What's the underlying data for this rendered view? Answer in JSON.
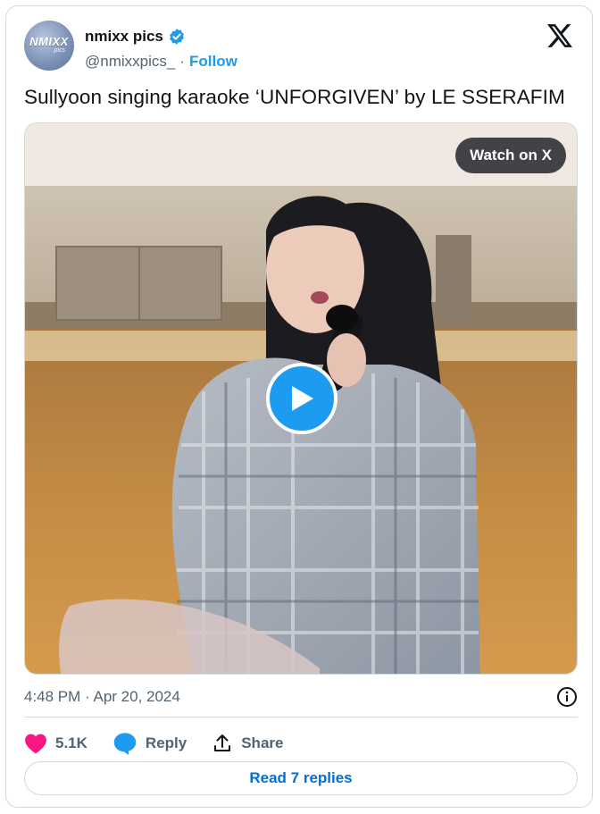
{
  "author": {
    "avatar_text": "NMIXX",
    "avatar_sub": "pics",
    "display_name": "nmixx pics",
    "handle": "@nmixxpics_",
    "separator": "·",
    "follow_label": "Follow"
  },
  "tweet": {
    "text": "Sullyoon singing karaoke ‘UNFORGIVEN’ by LE SSERAFIM"
  },
  "media": {
    "watch_label": "Watch on X"
  },
  "meta": {
    "timestamp": "4:48 PM · Apr 20, 2024"
  },
  "actions": {
    "like_count": "5.1K",
    "reply_label": "Reply",
    "share_label": "Share"
  },
  "replies": {
    "read_label": "Read 7 replies"
  },
  "colors": {
    "accent": "#1d9bf0",
    "like": "#f91880",
    "link": "#006fd6",
    "muted": "#536471"
  },
  "icons": [
    "verified-badge-icon",
    "x-logo-icon",
    "play-icon",
    "info-icon",
    "heart-icon",
    "reply-bubble-icon",
    "share-icon"
  ]
}
